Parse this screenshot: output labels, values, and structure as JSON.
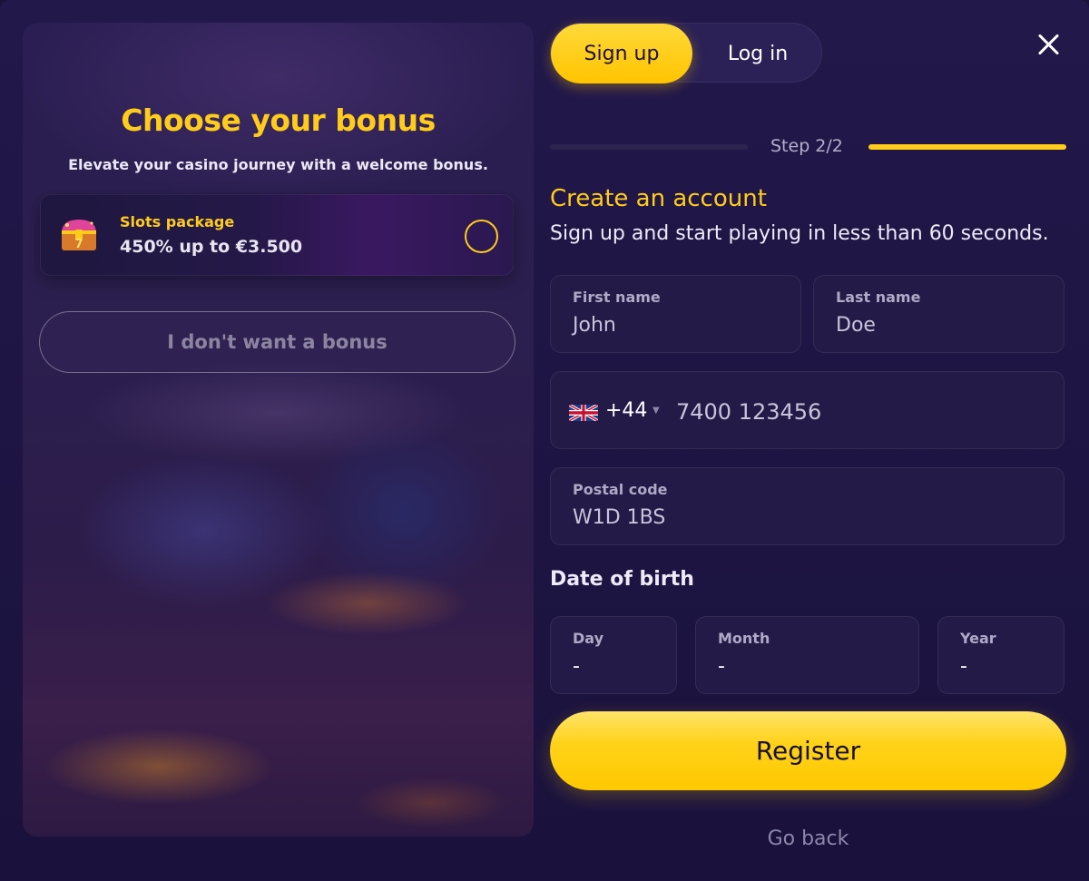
{
  "bonus_panel": {
    "title": "Choose your bonus",
    "subtitle": "Elevate your casino journey with a welcome bonus.",
    "bonus": {
      "name": "Slots package",
      "amount": "450% up to €3.500",
      "icon": "treasure-chest-icon"
    },
    "no_bonus_label": "I don't want a bonus"
  },
  "tabs": {
    "signup_label": "Sign up",
    "login_label": "Log in",
    "active": "Sign up"
  },
  "step": {
    "label": "Step 2/2"
  },
  "form": {
    "title": "Create an account",
    "subtitle": "Sign up and start playing in less than 60 seconds.",
    "first_name": {
      "label": "First name",
      "placeholder": "John"
    },
    "last_name": {
      "label": "Last name",
      "placeholder": "Doe"
    },
    "phone": {
      "country_code": "+44",
      "flag": "uk-flag-icon",
      "placeholder": "7400 123456"
    },
    "postal_code": {
      "label": "Postal code",
      "placeholder": "W1D 1BS"
    },
    "dob_title": "Date of birth",
    "day": {
      "label": "Day",
      "value": "-"
    },
    "month": {
      "label": "Month",
      "value": "-"
    },
    "year": {
      "label": "Year",
      "value": "-"
    },
    "register_label": "Register",
    "go_back_label": "Go back"
  },
  "colors": {
    "accent": "#ffcc1a",
    "background": "#1d1442",
    "field": "#231a47"
  }
}
